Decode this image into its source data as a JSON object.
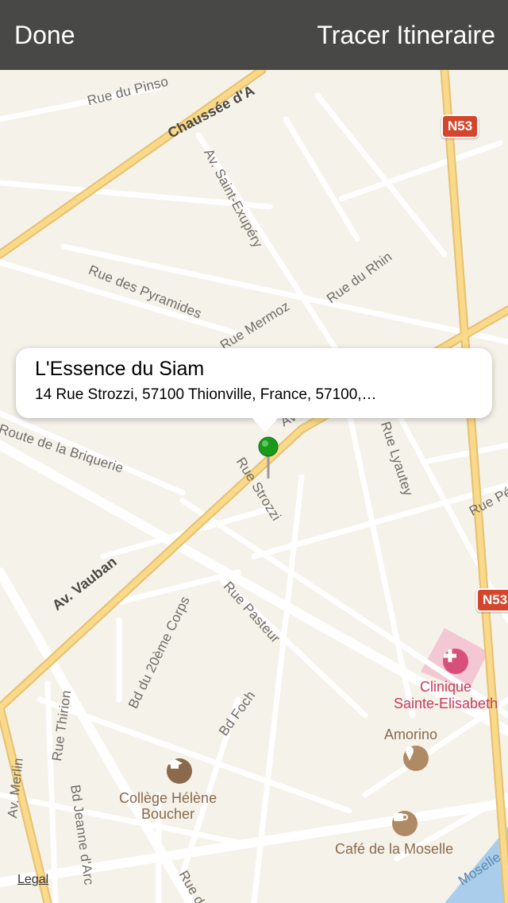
{
  "navbar": {
    "done_label": "Done",
    "route_label": "Tracer Itineraire"
  },
  "callout": {
    "title": "L'Essence du Siam",
    "address": "14 Rue Strozzi, 57100 Thionville, France, 57100,…"
  },
  "streets": {
    "rue_du_pinsot": "Rue du Pinso",
    "chaussee": "Chaussée d'A",
    "av_saint_exupery": "Av. Saint-Exupéry",
    "rue_du_rhin": "Rue du Rhin",
    "rue_des_pyramides": "Rue des Pyramides",
    "rue_mermoz": "Rue Mermoz",
    "route_de_la_briquerie": "Route de la Briquerie",
    "rue_strozzi": "Rue Strozzi",
    "rue_lyautey": "Rue Lyautey",
    "rue_pe": "Rue Pé",
    "av_vauban": "Av. Vauban",
    "rue_pasteur": "Rue Pasteur",
    "bd_20eme_corps": "Bd du 20ème Corps",
    "bd_foch": "Bd Foch",
    "rue_thirion": "Rue Thirion",
    "av_merlin": "Av. Merlin",
    "bd_jeanne_darc": "Bd Jeanne d'Arc",
    "rue_de": "Rue de",
    "moselle": "Moselle",
    "av_short": "Av"
  },
  "shields": {
    "n53_top": "N53",
    "n53_right": "N53"
  },
  "pois": {
    "clinique": "Clinique\nSainte-Elisabeth",
    "amorino": "Amorino",
    "college": "Collège Hélène\nBoucher",
    "cafe": "Café de la Moselle"
  },
  "legal": "Legal",
  "colors": {
    "navbar": "#484847",
    "map_bg": "#f5f2ea",
    "major_road": "#f7cf6b",
    "pin": "#1a9a1a",
    "hospital": "#d8507a"
  },
  "icons": {
    "pin": "pin-icon",
    "hospital": "hospital-cross-icon",
    "ice_cream": "ice-cream-icon",
    "school": "graduation-cap-icon",
    "cafe": "coffee-cup-icon"
  }
}
